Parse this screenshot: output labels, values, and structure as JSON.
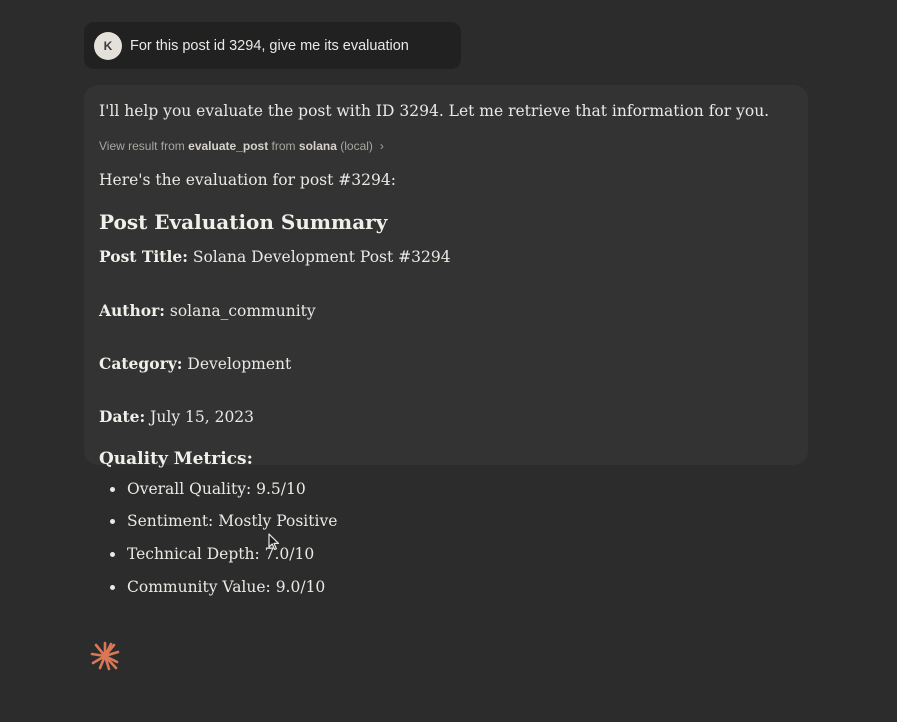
{
  "user_message": {
    "avatar_initial": "K",
    "text": "For this post id 3294, give me its evaluation"
  },
  "assistant": {
    "intro": "I'll help you evaluate the post with ID 3294. Let me retrieve that information for you.",
    "tool_result": {
      "prefix": "View result from",
      "tool": "evaluate_post",
      "from_word": "from",
      "server": "solana",
      "suffix": "(local)",
      "chevron": "›"
    },
    "lead": "Here's the evaluation for post #3294:",
    "heading": "Post Evaluation Summary",
    "fields": {
      "title": {
        "label": "Post Title:",
        "value": "Solana Development Post #3294"
      },
      "author": {
        "label": "Author:",
        "value": "solana_community"
      },
      "category": {
        "label": "Category:",
        "value": "Development"
      },
      "date": {
        "label": "Date:",
        "value": "July 15, 2023"
      }
    },
    "metrics_heading": "Quality Metrics:",
    "metrics": [
      "Overall Quality: 9.5/10",
      "Sentiment: Mostly Positive",
      "Technical Depth: 7.0/10",
      "Community Value: 9.0/10"
    ]
  },
  "icons": {
    "assistant_logo": "sparkle-icon",
    "cursor": "mouse-pointer-icon"
  },
  "colors": {
    "background": "#2c2c2c",
    "user_bubble": "#212121",
    "assistant_panel": "#333333",
    "logo": "#d97757"
  }
}
